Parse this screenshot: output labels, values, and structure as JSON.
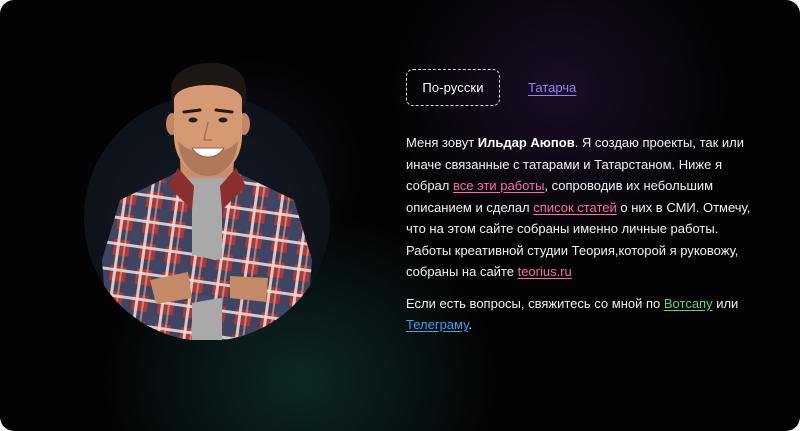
{
  "lang": {
    "active": "По-русски",
    "alternate": "Татарча"
  },
  "bio": {
    "intro": "Меня зовут ",
    "name": "Ильдар Аюпов",
    "part1": ". Я создаю проекты, так или иначе связанные с татарами и Татарстаном. Ниже я собрал ",
    "works_link": "все эти работы",
    "part2": ", сопроводив их небольшим описанием и сделал ",
    "articles_link": "список статей",
    "part3": " о них в СМИ. Отмечу, что на этом сайте собраны именно личные работы. Работы креативной студии Теория,которой я руковожу, собраны на сайте ",
    "studio_link": "teorius.ru"
  },
  "contact": {
    "text": "Если есть вопросы, свяжитесь со мной по ",
    "whatsapp_link": "Вотсапу",
    "or": " или ",
    "telegram_link": "Телеграму",
    "end": "."
  },
  "colors": {
    "background": "#030305",
    "link_pink": "#ff6aa7",
    "link_green": "#58d57a",
    "link_blue": "#38a2f0",
    "link_purple": "#8a84ff"
  }
}
